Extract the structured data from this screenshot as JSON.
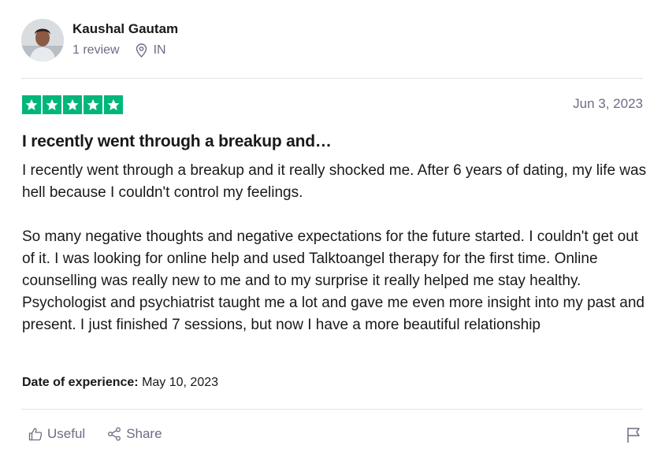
{
  "reviewer": {
    "name": "Kaushal Gautam",
    "review_count": "1 review",
    "country": "IN"
  },
  "review": {
    "rating": 5,
    "rating_max": 5,
    "star_color": "#00b67a",
    "date": "Jun 3, 2023",
    "title": "I recently went through a breakup and…",
    "paragraphs": [
      "I recently went through a breakup and it really shocked me. After 6 years of dating, my life was hell because I couldn't control my feelings.",
      "So many negative thoughts and negative expectations for the future started. I couldn't get out of it. I was looking for online help and used Talktoangel therapy for the first time. Online counselling was really new to me and to my surprise it really helped me stay healthy. Psychologist and psychiatrist taught me a lot and gave me even more insight into my past and present. I just finished 7 sessions, but now I have a more beautiful relationship"
    ],
    "experience_label": "Date of experience:",
    "experience_date": "May 10, 2023"
  },
  "actions": {
    "useful_label": "Useful",
    "share_label": "Share"
  },
  "icons": {
    "location": "map-pin-icon",
    "useful": "thumbs-up-icon",
    "share": "share-icon",
    "report": "flag-icon"
  }
}
